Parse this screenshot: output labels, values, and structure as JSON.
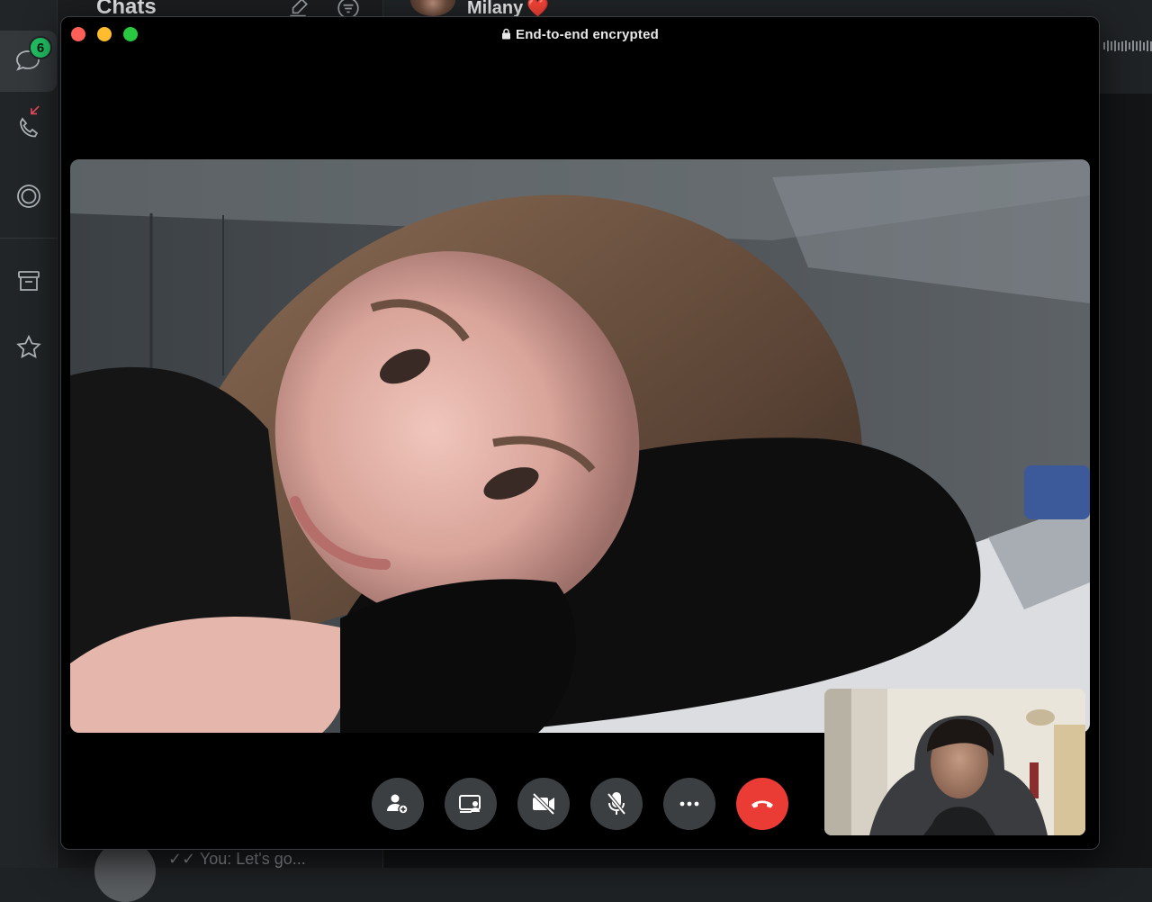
{
  "app": {
    "chat_list_title": "Chats",
    "unread_badge": "6",
    "contact_name": "Milany",
    "contact_emoji": "❤️",
    "bottom_preview": "You: Let's go..."
  },
  "sidebar": {
    "items": [
      {
        "name": "chats",
        "icon": "chat-bubble-icon"
      },
      {
        "name": "calls",
        "icon": "phone-missed-icon"
      },
      {
        "name": "status",
        "icon": "status-ring-icon"
      },
      {
        "name": "archived",
        "icon": "archive-icon"
      },
      {
        "name": "starred",
        "icon": "star-icon"
      }
    ]
  },
  "call": {
    "title": "End-to-end encrypted",
    "controls": [
      {
        "name": "add-participant",
        "icon": "person-add-icon"
      },
      {
        "name": "share-screen",
        "icon": "screen-share-icon"
      },
      {
        "name": "camera-off",
        "icon": "video-off-icon"
      },
      {
        "name": "mute",
        "icon": "mic-off-icon"
      },
      {
        "name": "more",
        "icon": "more-icon"
      },
      {
        "name": "end-call",
        "icon": "hang-up-icon"
      }
    ]
  },
  "colors": {
    "accent_green": "#21c063",
    "end_call_red": "#ea3b35",
    "missed_call_red": "#e84a5f"
  }
}
